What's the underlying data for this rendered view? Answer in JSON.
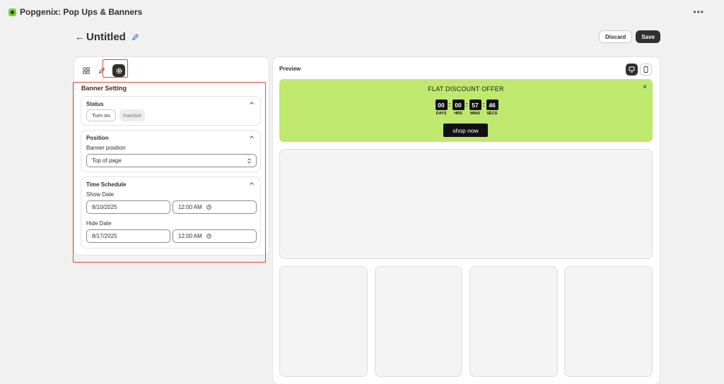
{
  "app": {
    "title": "Popgenix: Pop Ups & Banners",
    "menu": "•••"
  },
  "header": {
    "back": "←",
    "title": "Untitled",
    "discard_label": "Discard",
    "save_label": "Save"
  },
  "settings": {
    "section_title": "Banner Setting",
    "status": {
      "heading": "Status",
      "turn_on": "Turn on",
      "inactive": "Inactive"
    },
    "position": {
      "heading": "Position",
      "label": "Banner position",
      "selected": "Top of page"
    },
    "schedule": {
      "heading": "Time Schedule",
      "show_label": "Show Date",
      "show_date": "8/10/2025",
      "show_time": "12:00 AM",
      "hide_label": "Hide Date",
      "hide_date": "8/17/2025",
      "hide_time": "12:00 AM"
    }
  },
  "preview": {
    "label": "Preview",
    "banner": {
      "title": "FLAT DISCOUNT OFFER",
      "close": "×",
      "countdown": [
        {
          "value": "00",
          "label": "DAYS"
        },
        {
          "value": "00",
          "label": "HRS"
        },
        {
          "value": "57",
          "label": "MINS"
        },
        {
          "value": "46",
          "label": "SECS"
        }
      ],
      "sep": ":",
      "button": "shop now",
      "background": "#bfe86e"
    }
  },
  "colors": {
    "accent_dark": "#303030",
    "highlight": "#e0482f",
    "banner_bg": "#bfe86e"
  }
}
